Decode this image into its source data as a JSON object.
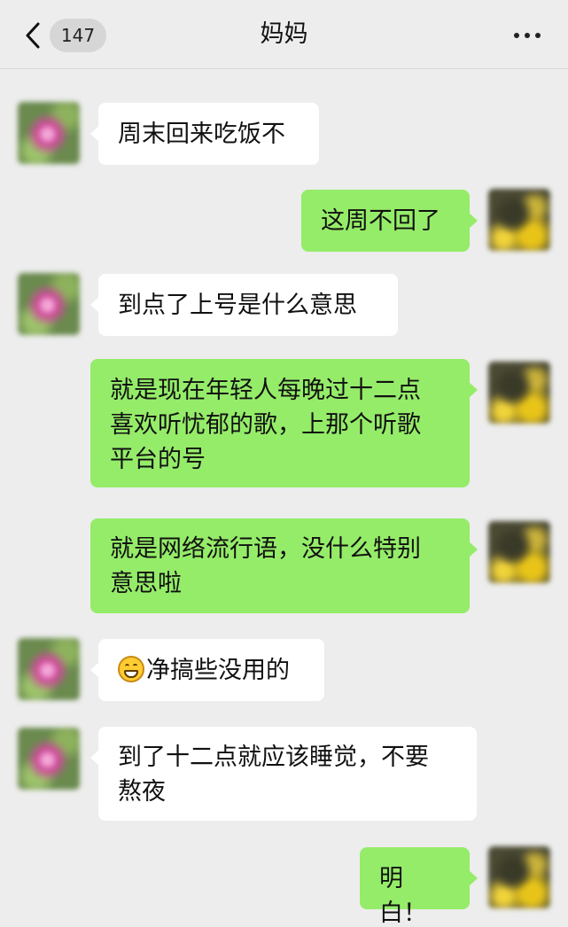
{
  "header": {
    "back_icon": "chevron-left-icon",
    "unread_count": "147",
    "title": "妈妈",
    "more_icon": "more-horizontal-icon"
  },
  "colors": {
    "background": "#ededed",
    "incoming_bubble": "#ffffff",
    "outgoing_bubble": "#95ec69"
  },
  "messages": [
    {
      "from": "mom",
      "text": "周末回来吃饭不"
    },
    {
      "from": "me",
      "text": "这周不回了"
    },
    {
      "from": "mom",
      "text": "到点了上号是什么意思"
    },
    {
      "from": "me",
      "lines": [
        "就是现在年轻人每晚过十二点",
        "喜欢听忧郁的歌，上那个听歌",
        "平台的号"
      ]
    },
    {
      "from": "me",
      "lines": [
        "就是网络流行语，没什么特别",
        "意思啦"
      ]
    },
    {
      "from": "mom",
      "emoji": "grin-icon",
      "text": "净搞些没用的"
    },
    {
      "from": "mom",
      "lines": [
        "到了十二点就应该睡觉，不要",
        "熬夜"
      ]
    },
    {
      "from": "me",
      "text": "明白！"
    }
  ]
}
